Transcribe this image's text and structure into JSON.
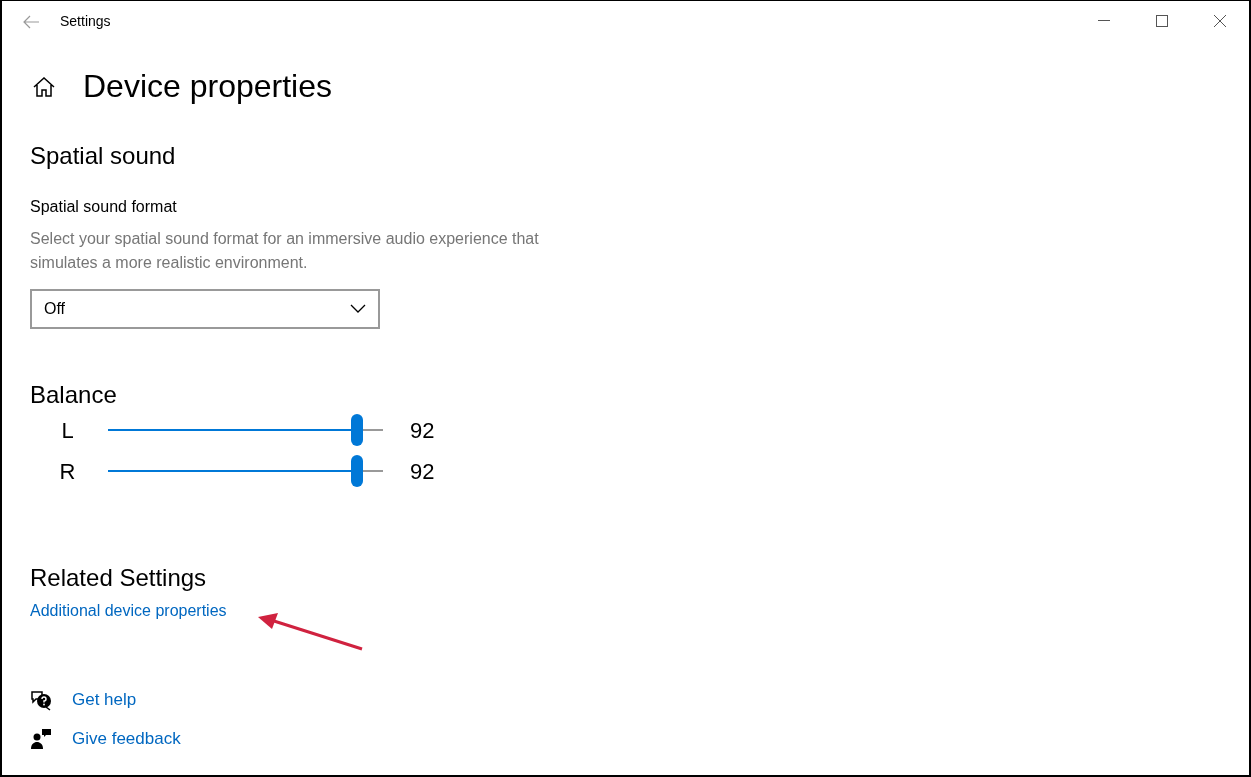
{
  "window": {
    "title": "Settings"
  },
  "page_title": "Device properties",
  "spatial_sound": {
    "heading": "Spatial sound",
    "label": "Spatial sound format",
    "description": "Select your spatial sound format for an immersive audio experience that simulates a more realistic environment.",
    "value": "Off"
  },
  "balance": {
    "heading": "Balance",
    "channels": [
      {
        "name": "L",
        "level": 0.905,
        "reading": "92"
      },
      {
        "name": "R",
        "level": 0.905,
        "reading": "92"
      }
    ]
  },
  "related": {
    "heading": "Related Settings",
    "link": "Additional device properties"
  },
  "help_links": [
    {
      "kind": "help",
      "label": "Get help"
    },
    {
      "kind": "feedback",
      "label": "Give feedback"
    }
  ]
}
